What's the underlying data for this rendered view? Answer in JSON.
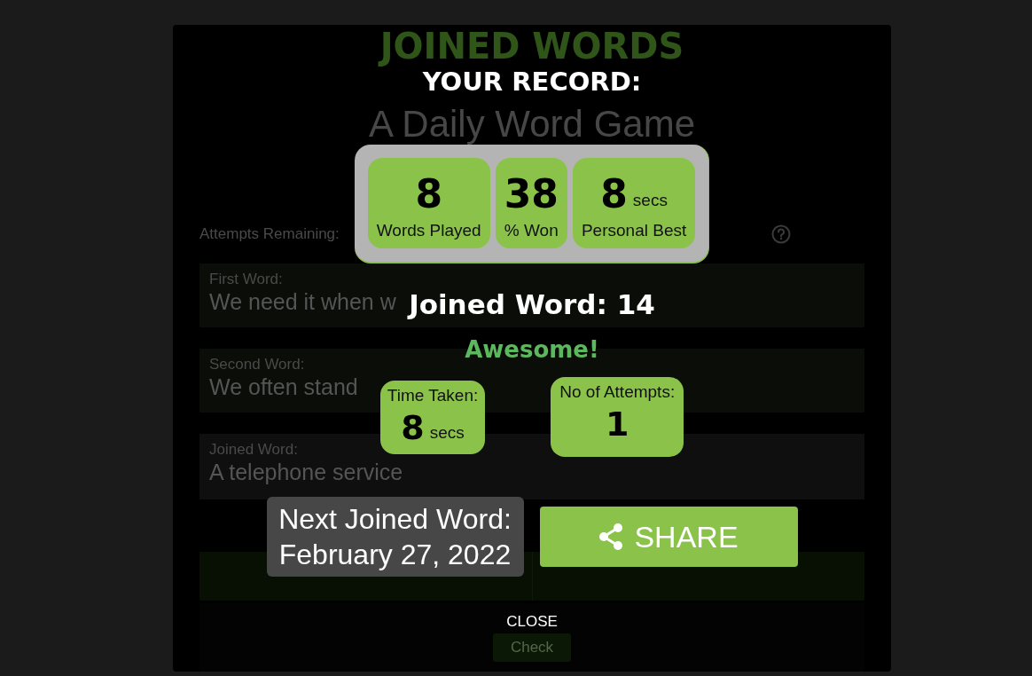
{
  "game": {
    "title": "JOINED WORDS",
    "subtitle": "A Daily Word Game",
    "attempts_label": "Attempts Remaining:",
    "clues": [
      {
        "label": "First Word:",
        "text": "We need it when w"
      },
      {
        "label": "Second Word:",
        "text": "We often stand"
      },
      {
        "label": "Joined Word:",
        "text": "A telephone service"
      }
    ],
    "check_button": "Check"
  },
  "modal": {
    "title": "YOUR RECORD:",
    "stats": [
      {
        "value": "8",
        "label": "Words Played"
      },
      {
        "value": "38",
        "label": "% Won"
      },
      {
        "value": "8",
        "unit": "secs",
        "label": "Personal Best"
      }
    ],
    "result_title": "Joined Word: 14",
    "praise": "Awesome!",
    "result_stats": [
      {
        "label": "Time Taken:",
        "value": "8",
        "unit": "secs"
      },
      {
        "label": "No of Attempts:",
        "value": "1"
      }
    ],
    "next_word": {
      "label": "Next Joined Word:",
      "date": "February 27, 2022"
    },
    "share_button": "SHARE",
    "close_button": "CLOSE"
  }
}
